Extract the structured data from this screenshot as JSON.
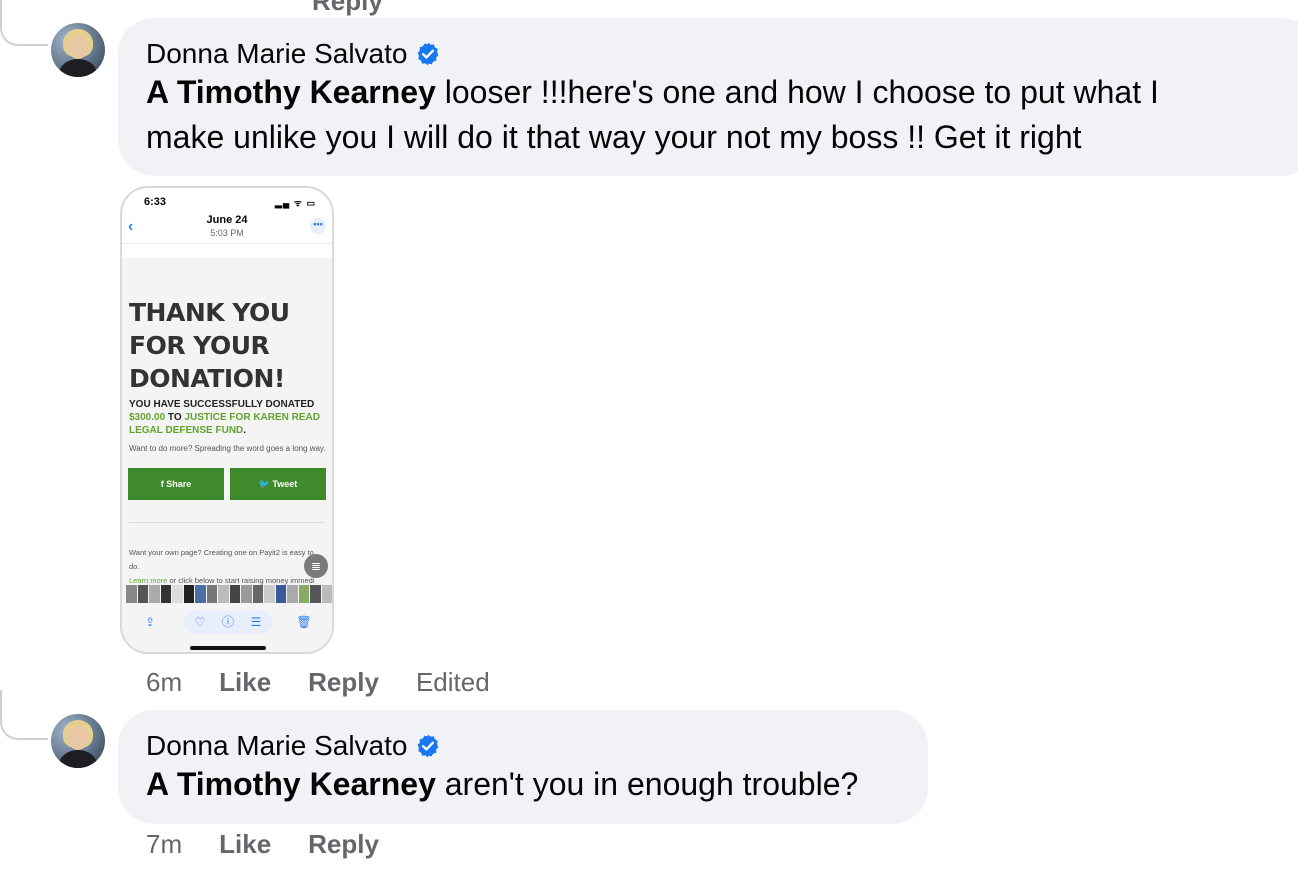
{
  "top_partial": {
    "reply_label": "Reply"
  },
  "comments": [
    {
      "author": "Donna Marie Salvato",
      "verified": true,
      "mention": "A Timothy Kearney",
      "text_line1": " looser !!!here's one and how I choose to put what I",
      "text_line2": "make unlike you I will do it that way your not my boss !! Get it right",
      "attachment": {
        "status_time": "6:33",
        "status_signal": "▂▄ ᯤ ▭",
        "back_icon": "chevron-left-icon",
        "date": "June 24",
        "time": "5:03 PM",
        "more_glyph": "•••",
        "headline": [
          "THANK YOU",
          "FOR YOUR",
          "DONATION!"
        ],
        "donated_prefix": "YOU HAVE SUCCESSFULLY DONATED",
        "amount": "$300.00",
        "to_word": " TO ",
        "fund": "JUSTICE FOR KAREN READ LEGAL DEFENSE FUND",
        "period": ".",
        "small_text": "Want to do more? Spreading the word goes a long way.",
        "share_label": "f  Share",
        "tweet_label": "🐦 Tweet",
        "own_page_line1": "Want your own page? Creating one on Payit2 is easy to do.",
        "learn_more": "Learn more",
        "own_page_line2": " or click below to start raising money immedi",
        "thumb_colors": [
          "#888",
          "#555",
          "#aaa",
          "#333",
          "#ddd",
          "#222",
          "#4a6fa5",
          "#777",
          "#bbb",
          "#444",
          "#999",
          "#666",
          "#ccc",
          "#3b5998",
          "#aaa",
          "#8a6",
          "#555",
          "#bbb"
        ]
      },
      "actions": {
        "time": "6m",
        "like": "Like",
        "reply": "Reply",
        "edited": "Edited"
      }
    },
    {
      "author": "Donna Marie Salvato",
      "verified": true,
      "mention": "A Timothy Kearney",
      "text": " aren't you in enough trouble?",
      "actions": {
        "time": "7m",
        "like": "Like",
        "reply": "Reply"
      }
    }
  ],
  "colors": {
    "bubble": "#f0f2f5",
    "verified": "#1877f2",
    "meta": "#65676b",
    "donation_green": "#63a22e",
    "button_green": "#3f8a2a"
  }
}
